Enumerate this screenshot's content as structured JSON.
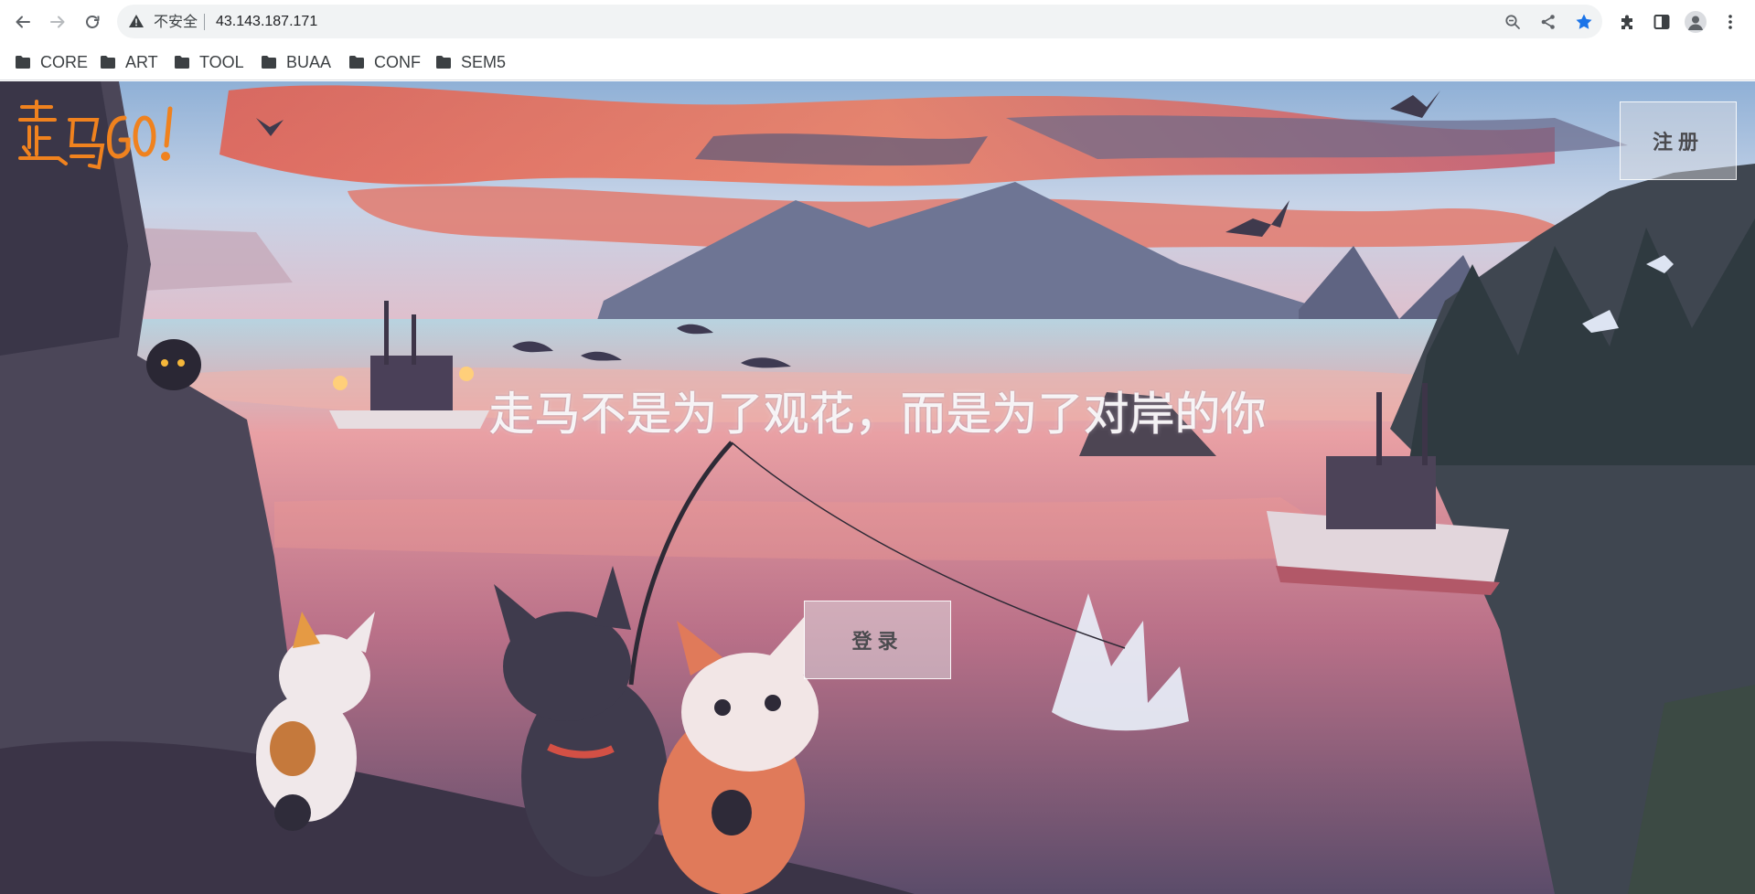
{
  "browser": {
    "security_label": "不安全",
    "url": "43.143.187.171",
    "icons": {
      "back": "back-arrow-icon",
      "forward": "forward-arrow-icon",
      "reload": "reload-icon",
      "warning": "warning-icon",
      "zoom": "zoom-icon",
      "share": "share-icon",
      "bookmark": "star-icon",
      "extensions": "puzzle-icon",
      "side_panel": "side-panel-icon",
      "profile": "avatar-icon",
      "menu": "kebab-menu-icon"
    },
    "accent_color": "#1a73e8"
  },
  "bookmarks": [
    {
      "label": "CORE"
    },
    {
      "label": "ART"
    },
    {
      "label": "TOOL"
    },
    {
      "label": "BUAA"
    },
    {
      "label": "CONF"
    },
    {
      "label": "SEM5"
    }
  ],
  "page": {
    "logo_text": "走马GO!",
    "logo_color": "#f0821e",
    "register_label": "注册",
    "headline": "走马不是为了观花，而是为了对岸的你",
    "login_label": "登录"
  }
}
